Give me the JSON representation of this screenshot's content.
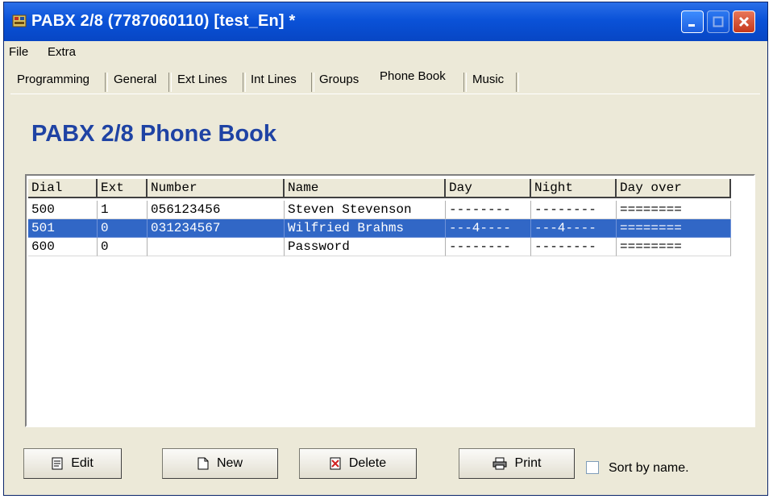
{
  "window": {
    "title": "PABX 2/8 (7787060110) [test_En] *",
    "controls": {
      "minimize": "_",
      "maximize": "□",
      "close": "✕"
    }
  },
  "menu": {
    "items": [
      "File",
      "Extra"
    ]
  },
  "tabs": {
    "items": [
      "Programming",
      "General",
      "Ext Lines",
      "Int Lines",
      "Groups",
      "Phone Book",
      "Music"
    ],
    "active": "Phone Book"
  },
  "page": {
    "title": "PABX 2/8 Phone Book"
  },
  "table": {
    "columns": [
      "Dial",
      "Ext",
      "Number",
      "Name",
      "Day",
      "Night",
      "Day over"
    ],
    "rows": [
      {
        "dial": "500",
        "ext": "1",
        "number": "056123456",
        "name": "Steven Stevenson",
        "day": "--------",
        "night": "--------",
        "day_over": "========"
      },
      {
        "dial": "501",
        "ext": "0",
        "number": "031234567",
        "name": "Wilfried Brahms",
        "day": "---4----",
        "night": "---4----",
        "day_over": "========",
        "selected": true
      },
      {
        "dial": "600",
        "ext": "0",
        "number": "",
        "name": "Password",
        "day": "--------",
        "night": "--------",
        "day_over": "========"
      }
    ]
  },
  "buttons": {
    "edit": {
      "label": "Edit",
      "icon": "document-icon"
    },
    "new": {
      "label": "New",
      "icon": "new-document-icon"
    },
    "delete": {
      "label": "Delete",
      "icon": "delete-document-icon"
    },
    "print": {
      "label": "Print",
      "icon": "printer-icon"
    }
  },
  "options": {
    "sort_by_name_label": "Sort by name.",
    "sort_by_name_checked": false
  },
  "colors": {
    "title_blue": "#1f43a4",
    "selection": "#3167c6",
    "window_bg": "#ece9d8"
  }
}
